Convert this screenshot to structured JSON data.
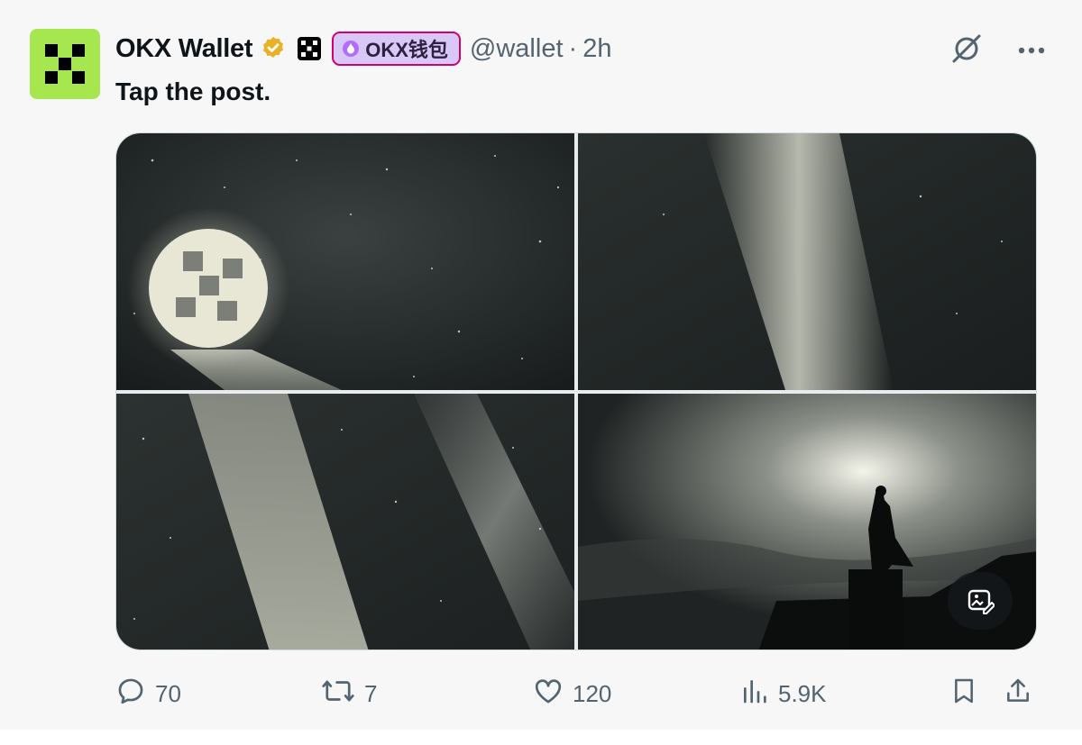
{
  "author": {
    "name": "OKX Wallet",
    "badge_label": "OKX钱包",
    "handle": "@wallet",
    "separator": "·",
    "time": "2h"
  },
  "post": {
    "text": "Tap the post."
  },
  "actions": {
    "replies": "70",
    "reposts": "7",
    "likes": "120",
    "views": "5.9K"
  },
  "icons": {
    "verified": "verified-badge-icon",
    "grok": "grok-icon",
    "more": "more-icon",
    "alt": "image-alt-icon",
    "reply": "reply-icon",
    "repost": "repost-icon",
    "like": "heart-icon",
    "views": "views-icon",
    "bookmark": "bookmark-icon",
    "share": "share-icon"
  },
  "colors": {
    "avatar_bg": "#a6e64f",
    "badge_bg": "#d9c8f7",
    "badge_border": "#d0006f",
    "verified": "#e8b126",
    "muted_text": "#536471"
  }
}
